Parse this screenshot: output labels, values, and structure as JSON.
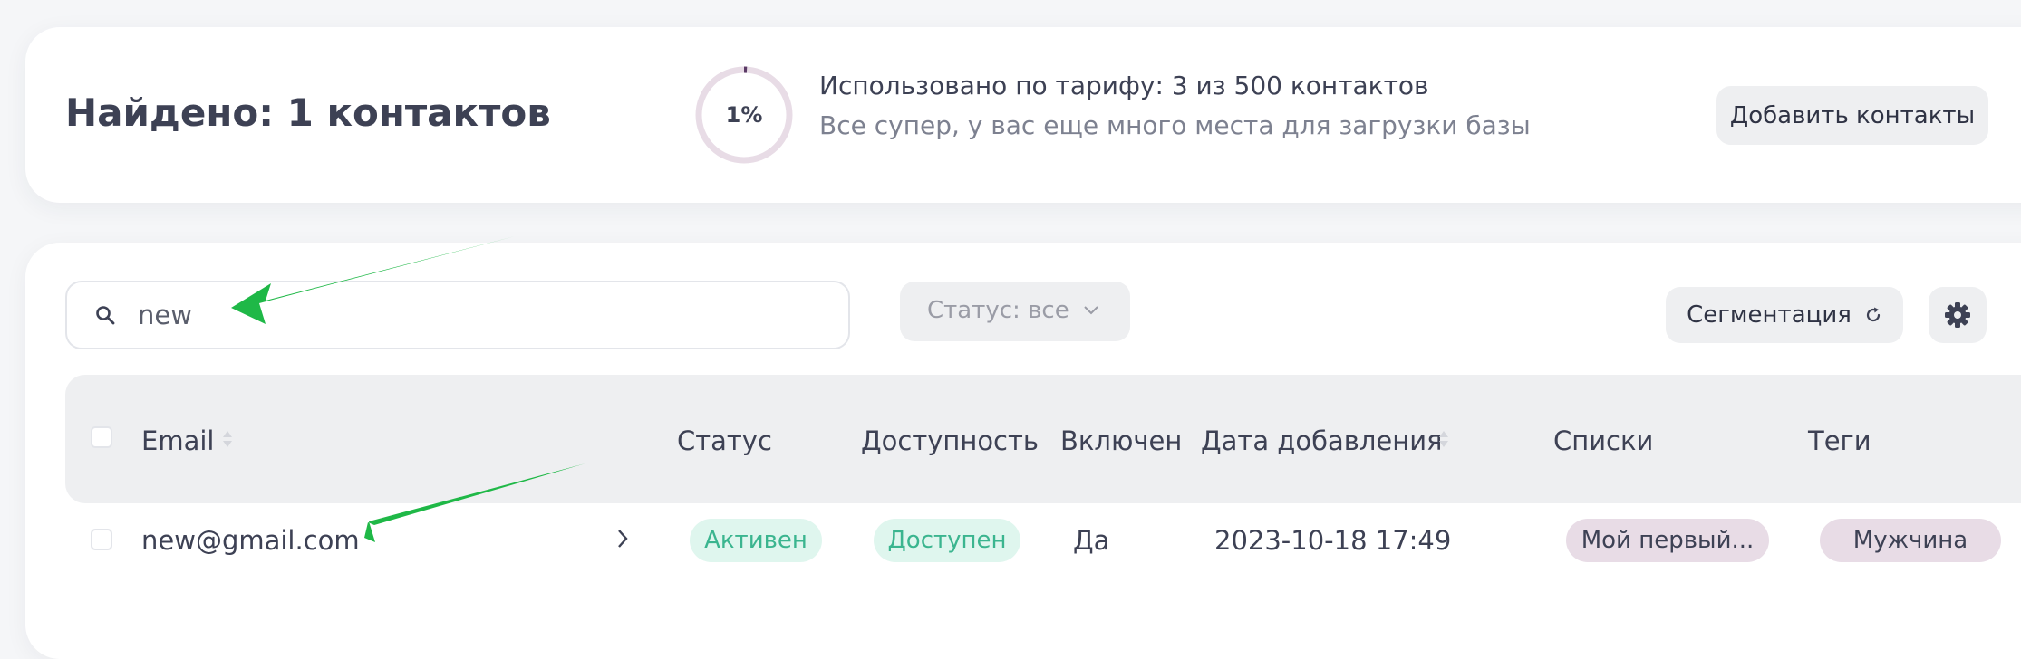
{
  "summary": {
    "found_title": "Найдено: 1 контактов",
    "usage_percent": "1%",
    "usage_fraction": 0.01,
    "usage_line1": "Использовано по тарифу: 3 из 500 контактов",
    "usage_line2": "Все супер, у вас еще много места для загрузки базы",
    "add_button": "Добавить контакты"
  },
  "toolbar": {
    "search_value": "new",
    "status_filter": "Статус: все",
    "segmentation_button": "Сегментация"
  },
  "table": {
    "columns": [
      "Email",
      "Статус",
      "Доступность",
      "Включен",
      "Дата добавления",
      "Списки",
      "Теги"
    ],
    "rows": [
      {
        "email": "new@gmail.com",
        "status": "Активен",
        "availability": "Доступен",
        "enabled": "Да",
        "date_added": "2023-10-18 17:49",
        "lists": "Мой первый...",
        "tags": "Мужчина"
      }
    ]
  },
  "colors": {
    "ring_track": "#e8dce6",
    "ring_progress": "#5b3a66",
    "annotation_arrow": "#1fb847",
    "status_green": "#3bb58f"
  },
  "icons": [
    "search-icon",
    "chevron-down-icon",
    "refresh-icon",
    "gear-icon",
    "sort-icon",
    "chevron-right-icon",
    "arrow-annotation"
  ]
}
